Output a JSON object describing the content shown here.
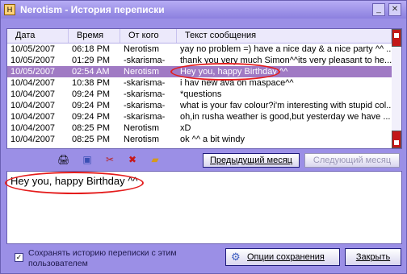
{
  "window": {
    "title": "Nerotism - История переписки"
  },
  "list": {
    "columns": [
      "Дата",
      "Время",
      "От кого",
      "Текст сообщения"
    ],
    "rows": [
      {
        "date": "10/05/2007",
        "time": "06:18 PM",
        "from": "Nerotism",
        "text": "yay no problem =) have a nice day & a nice party ^^ ..."
      },
      {
        "date": "10/05/2007",
        "time": "01:29 PM",
        "from": "-skarisma-",
        "text": "thank you very much Simon^^its very pleasant to he..."
      },
      {
        "date": "10/05/2007",
        "time": "02:54 AM",
        "from": "Nerotism",
        "text": "Hey you, happy Birthday ^^"
      },
      {
        "date": "10/04/2007",
        "time": "10:38 PM",
        "from": "-skarisma-",
        "text": "i hav new ava on maspace^^"
      },
      {
        "date": "10/04/2007",
        "time": "09:24 PM",
        "from": "-skarisma-",
        "text": "*questions"
      },
      {
        "date": "10/04/2007",
        "time": "09:24 PM",
        "from": "-skarisma-",
        "text": "what is your fav colour?i'm interesting with stupid col..."
      },
      {
        "date": "10/04/2007",
        "time": "09:24 PM",
        "from": "-skarisma-",
        "text": "oh,in rusha weather is good,but yesterday we have ..."
      },
      {
        "date": "10/04/2007",
        "time": "08:25 PM",
        "from": "Nerotism",
        "text": "xD"
      },
      {
        "date": "10/04/2007",
        "time": "08:25 PM",
        "from": "Nerotism",
        "text": "ok ^^ a bit windy"
      }
    ]
  },
  "buttons": {
    "prev_month": "Предыдущий месяц",
    "next_month": "Следующий месяц",
    "save_options": "Опции сохранения",
    "close": "Закрыть"
  },
  "compose": {
    "text": "Hey you, happy Birthday ^^"
  },
  "save_history": {
    "label": "Сохранять историю переписки с этим пользователем",
    "checked": true
  },
  "colors": {
    "frame": "#9b8fe6",
    "selected_row": "#a07ac4",
    "highlight": "#e41c1c"
  }
}
